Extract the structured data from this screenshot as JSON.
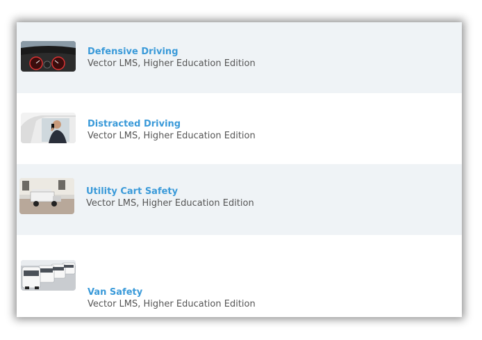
{
  "courses": [
    {
      "title": "Defensive Driving",
      "subtitle": "Vector LMS, Higher Education Edition",
      "thumbnail_icon": "car-dashboard-image"
    },
    {
      "title": "Distracted Driving",
      "subtitle": "Vector LMS, Higher Education Edition",
      "thumbnail_icon": "driver-on-phone-image"
    },
    {
      "title": "Utility Cart Safety",
      "subtitle": "Vector LMS, Higher Education Edition",
      "thumbnail_icon": "utility-cart-image"
    },
    {
      "title": "Van Safety",
      "subtitle": "Vector LMS, Higher Education Edition",
      "thumbnail_icon": "white-vans-image"
    }
  ],
  "colors": {
    "title": "#3a9ad9",
    "subtitle": "#555555",
    "row_shade": "#eff3f6",
    "row_plain": "#ffffff"
  }
}
